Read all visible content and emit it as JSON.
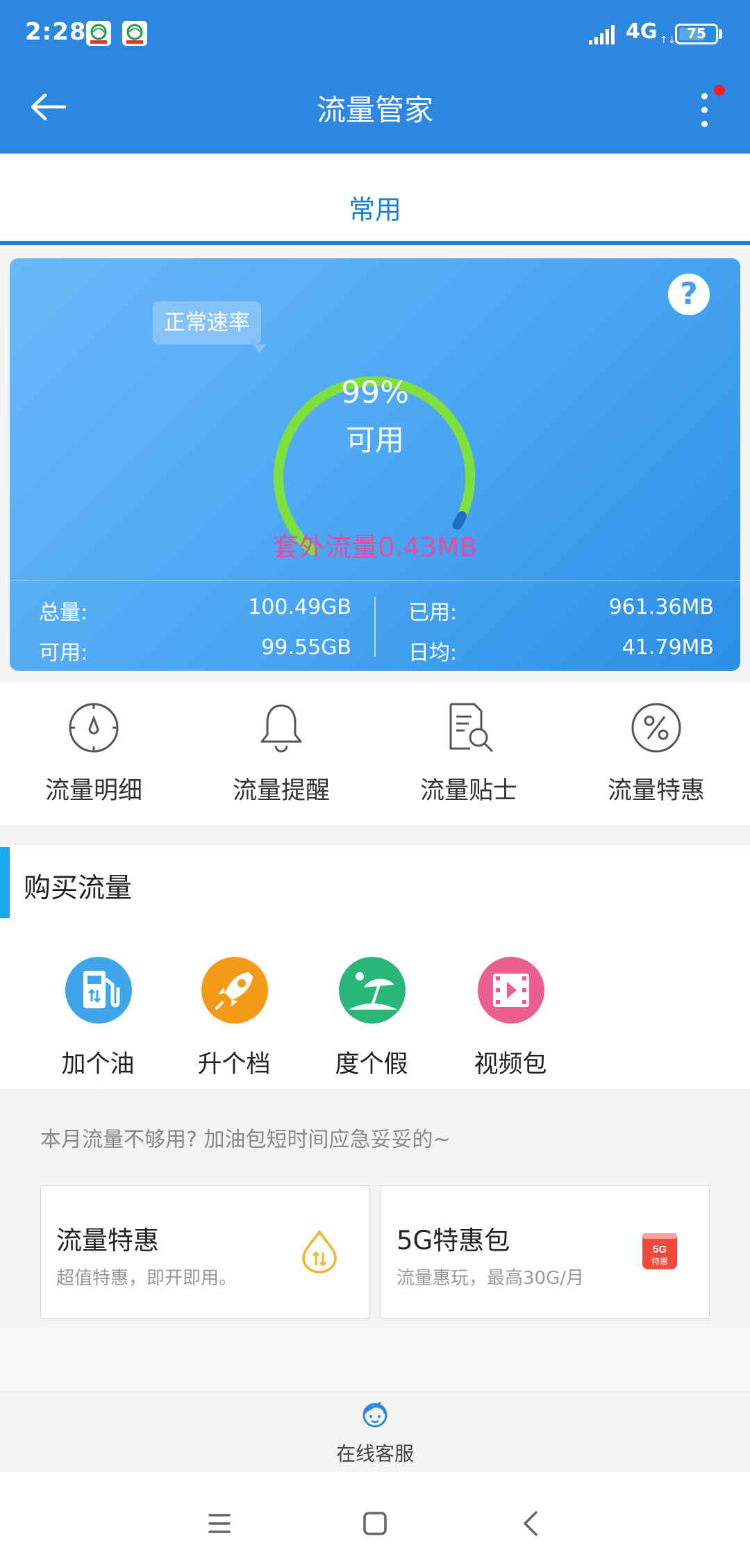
{
  "status_bar": {
    "time": "2:28",
    "network": "4G",
    "battery": "75",
    "battery_level": 0.75
  },
  "app_bar": {
    "title": "流量管家",
    "back_icon": "arrow-left-icon",
    "more_icon": "more-vertical-icon"
  },
  "tabs": [
    {
      "label": "常用",
      "active": true
    }
  ],
  "gauge": {
    "speed_tag": "正常速率",
    "percent": "99%",
    "percent_value": 99,
    "label": "可用",
    "extra_traffic": "套外流量0.43MB",
    "stats": {
      "total_label": "总量:",
      "total_value": "100.49GB",
      "used_label": "已用:",
      "used_value": "961.36MB",
      "available_label": "可用:",
      "available_value": "99.55GB",
      "daily_label": "日均:",
      "daily_value": "41.79MB"
    }
  },
  "features": [
    {
      "label": "流量明细",
      "icon": "compass-icon"
    },
    {
      "label": "流量提醒",
      "icon": "bell-icon"
    },
    {
      "label": "流量贴士",
      "icon": "document-search-icon"
    },
    {
      "label": "流量特惠",
      "icon": "percent-icon"
    }
  ],
  "buy": {
    "title": "购买流量",
    "packs": [
      {
        "label": "加个油",
        "icon": "fuel-pump-icon",
        "color": "#3fa5ea"
      },
      {
        "label": "升个档",
        "icon": "rocket-icon",
        "color": "#f49a1a"
      },
      {
        "label": "度个假",
        "icon": "beach-umbrella-icon",
        "color": "#28b679"
      },
      {
        "label": "视频包",
        "icon": "video-icon",
        "color": "#ea5f8e"
      }
    ],
    "hint": "本月流量不够用? 加油包短时间应急妥妥的~"
  },
  "promos": [
    {
      "title": "流量特惠",
      "desc": "超值特惠，即开即用。",
      "icon": "data-drop-icon"
    },
    {
      "title": "5G特惠包",
      "desc": "流量惠玩，最高30G/月",
      "icon": "5g-badge-icon"
    }
  ],
  "service": {
    "label": "在线客服",
    "icon": "customer-service-icon"
  },
  "colors": {
    "primary": "#2b87e0",
    "tab_accent": "#1a7fd6",
    "gauge_arc": "#7ee03a",
    "extra_traffic": "#e34da4",
    "buy_accent": "#18a7f0"
  }
}
